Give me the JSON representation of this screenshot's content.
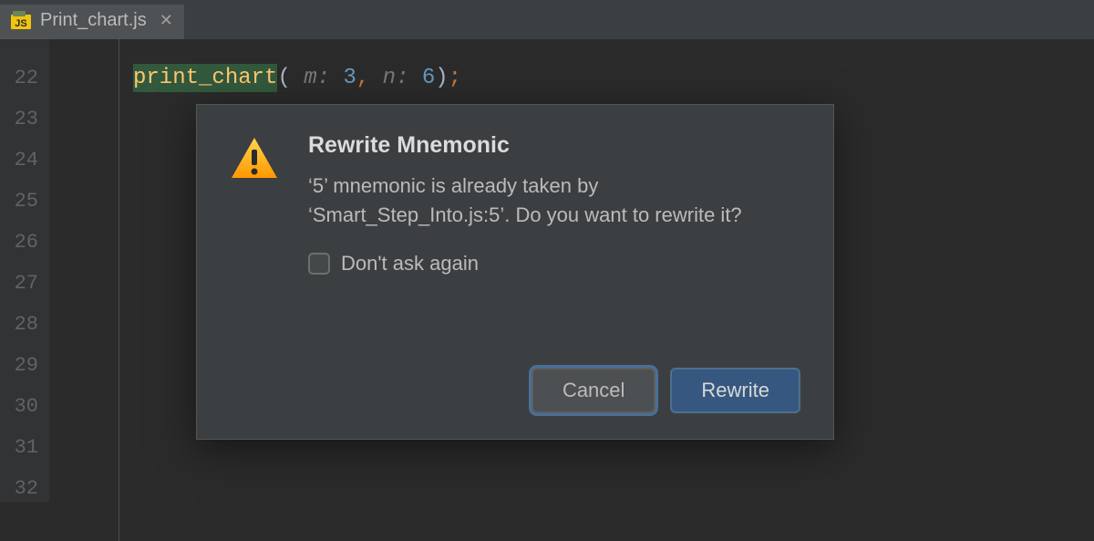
{
  "tab": {
    "filename": "Print_chart.js",
    "icon": "js-file-icon"
  },
  "gutter": {
    "start": 22,
    "end": 32
  },
  "code": {
    "fn": "print_chart",
    "hint1": " m: ",
    "arg1": "3",
    "hint2": " n: ",
    "arg2": "6"
  },
  "dialog": {
    "title": "Rewrite Mnemonic",
    "message": "‘5’ mnemonic is already taken by ‘Smart_Step_Into.js:5’. Do you want to rewrite it?",
    "checkbox_label": "Don't ask again",
    "cancel": "Cancel",
    "confirm": "Rewrite"
  }
}
